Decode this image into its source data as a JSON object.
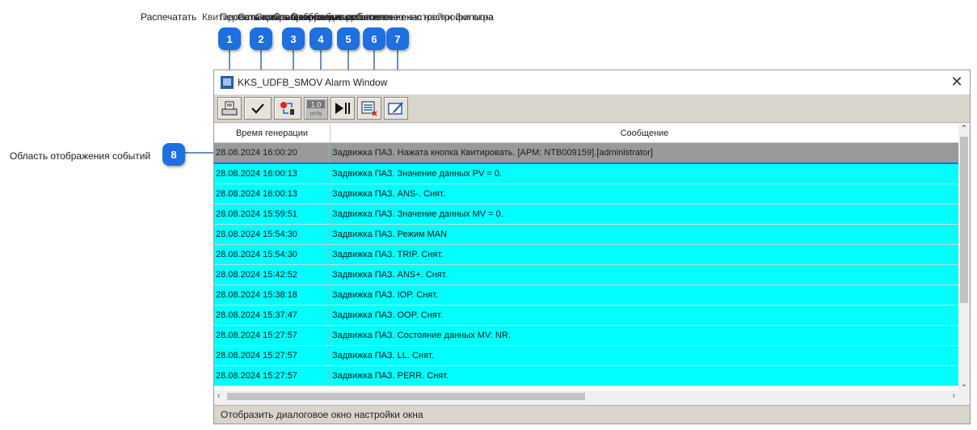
{
  "callouts": {
    "first_label": "Распечатать",
    "overlapping_labels": [
      "Квитировать выбранные события",
      "Переключить",
      "Остановить/возобновить обновление",
      "Скрыть выбранные события",
      "Отобразить диалоговое окно настройки фильтра",
      "Отобразить диалоговое окно настройки окна"
    ],
    "badges": [
      "1",
      "2",
      "3",
      "4",
      "5",
      "6",
      "7",
      "8"
    ],
    "side_label": "Область отображения событий"
  },
  "window": {
    "title": "KKS_UDFB_SMOV Alarm Window",
    "close_icon": "close-icon"
  },
  "toolbar": {
    "buttons": [
      "print-icon",
      "check-icon",
      "toggle-icon",
      "units-icon",
      "play-pause-icon",
      "hide-list-icon",
      "edit-settings-icon"
    ],
    "units_value": "1.0",
    "units_label": "m³/s"
  },
  "grid": {
    "columns": [
      "Время генерации",
      "Сообщение"
    ],
    "rows": [
      {
        "time": "28.08.2024 16:00:20",
        "message": "Задвижка ПАЗ. Нажата кнопка Квитировать. [АРМ: NTB009159].[administrator]"
      },
      {
        "time": "28.08.2024 16:00:13",
        "message": "Задвижка ПАЗ. Значение данных PV = 0."
      },
      {
        "time": "28.08.2024 16:00:13",
        "message": "Задвижка ПАЗ. ANS-. Снят."
      },
      {
        "time": "28.08.2024 15:59:51",
        "message": "Задвижка ПАЗ. Значение данных MV = 0."
      },
      {
        "time": "28.08.2024 15:54:30",
        "message": "Задвижка ПАЗ. Режим MAN"
      },
      {
        "time": "28.08.2024 15:54:30",
        "message": "Задвижка ПАЗ. TRIP. Снят."
      },
      {
        "time": "28.08.2024 15:42:52",
        "message": "Задвижка ПАЗ. ANS+. Снят."
      },
      {
        "time": "28.08.2024 15:38:18",
        "message": "Задвижка ПАЗ. IOP. Снят."
      },
      {
        "time": "28.08.2024 15:37:47",
        "message": "Задвижка ПАЗ. OOP. Снят."
      },
      {
        "time": "28.08.2024 15:27:57",
        "message": "Задвижка ПАЗ. Состояние данных MV: NR."
      },
      {
        "time": "28.08.2024 15:27:57",
        "message": "Задвижка ПАЗ. LL. Снят."
      },
      {
        "time": "28.08.2024 15:27:57",
        "message": "Задвижка ПАЗ. PERR. Снят."
      }
    ]
  },
  "statusbar": {
    "text": "Отобразить диалоговое окно настройки окна"
  },
  "colors": {
    "row_bg": "#00ffff",
    "selected_row_bg": "#999999",
    "badge": "#1e6fe0"
  }
}
